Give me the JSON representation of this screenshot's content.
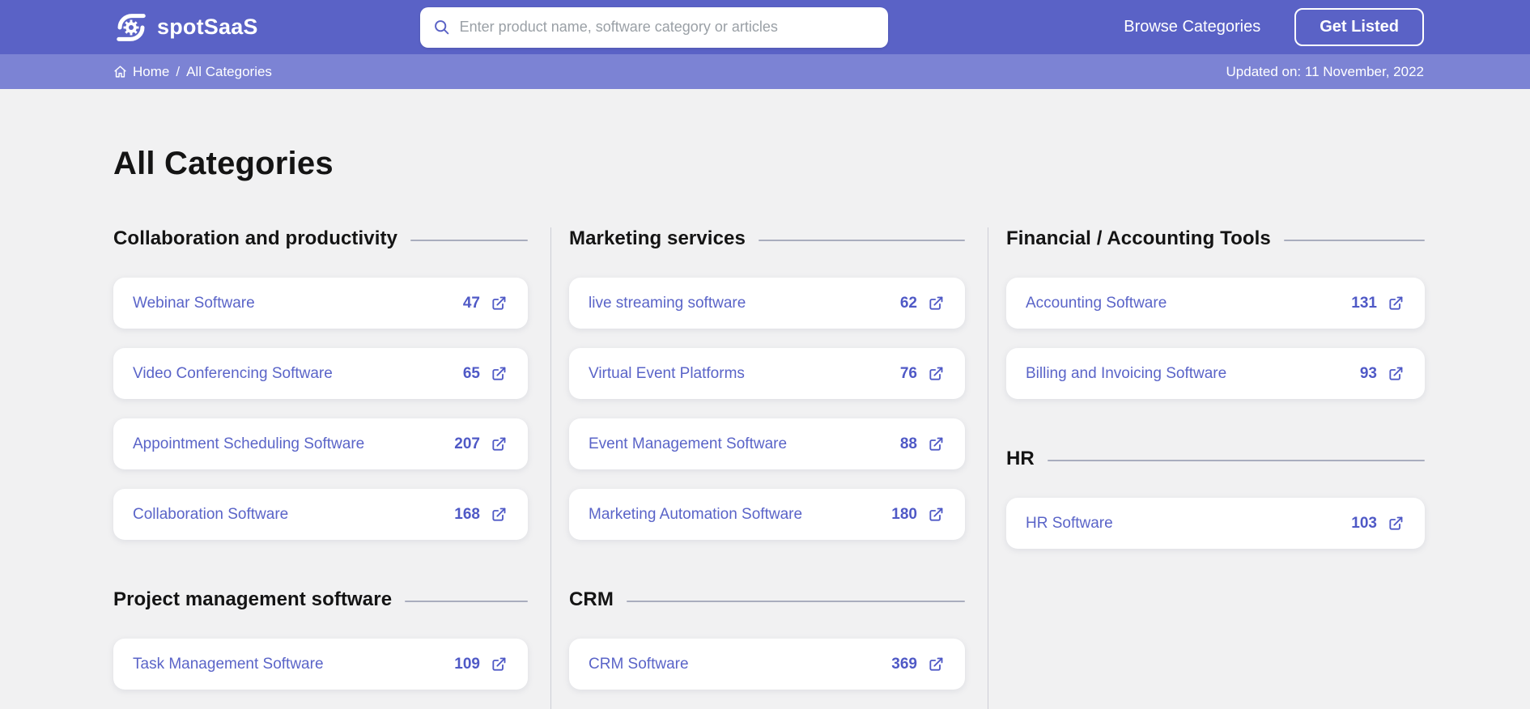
{
  "header": {
    "brand": "spotSaaS",
    "search_placeholder": "Enter product name, software category or articles",
    "nav_browse": "Browse Categories",
    "get_listed": "Get Listed"
  },
  "breadcrumb": {
    "home": "Home",
    "separator": "/",
    "current": "All Categories",
    "updated": "Updated on: 11 November, 2022"
  },
  "page": {
    "title": "All Categories"
  },
  "columns": [
    {
      "sections": [
        {
          "title": "Collaboration and productivity",
          "items": [
            {
              "label": "Webinar Software",
              "count": "47"
            },
            {
              "label": "Video Conferencing Software",
              "count": "65"
            },
            {
              "label": "Appointment Scheduling Software",
              "count": "207"
            },
            {
              "label": "Collaboration Software",
              "count": "168"
            }
          ]
        },
        {
          "title": "Project management software",
          "items": [
            {
              "label": "Task Management Software",
              "count": "109"
            }
          ]
        }
      ]
    },
    {
      "sections": [
        {
          "title": "Marketing services",
          "items": [
            {
              "label": "live streaming software",
              "count": "62"
            },
            {
              "label": "Virtual Event Platforms",
              "count": "76"
            },
            {
              "label": "Event Management Software",
              "count": "88"
            },
            {
              "label": "Marketing Automation Software",
              "count": "180"
            }
          ]
        },
        {
          "title": "CRM",
          "items": [
            {
              "label": "CRM Software",
              "count": "369"
            }
          ]
        }
      ]
    },
    {
      "sections": [
        {
          "title": "Financial / Accounting Tools",
          "items": [
            {
              "label": "Accounting Software",
              "count": "131"
            },
            {
              "label": "Billing and Invoicing Software",
              "count": "93"
            }
          ]
        },
        {
          "title": "HR",
          "items": [
            {
              "label": "HR Software",
              "count": "103"
            }
          ]
        }
      ]
    }
  ],
  "colors": {
    "header_bg": "#5A62C6",
    "breadcrumb_bg": "#7C83D4",
    "accent": "#5A64C8",
    "page_bg": "#F1F1F2"
  }
}
